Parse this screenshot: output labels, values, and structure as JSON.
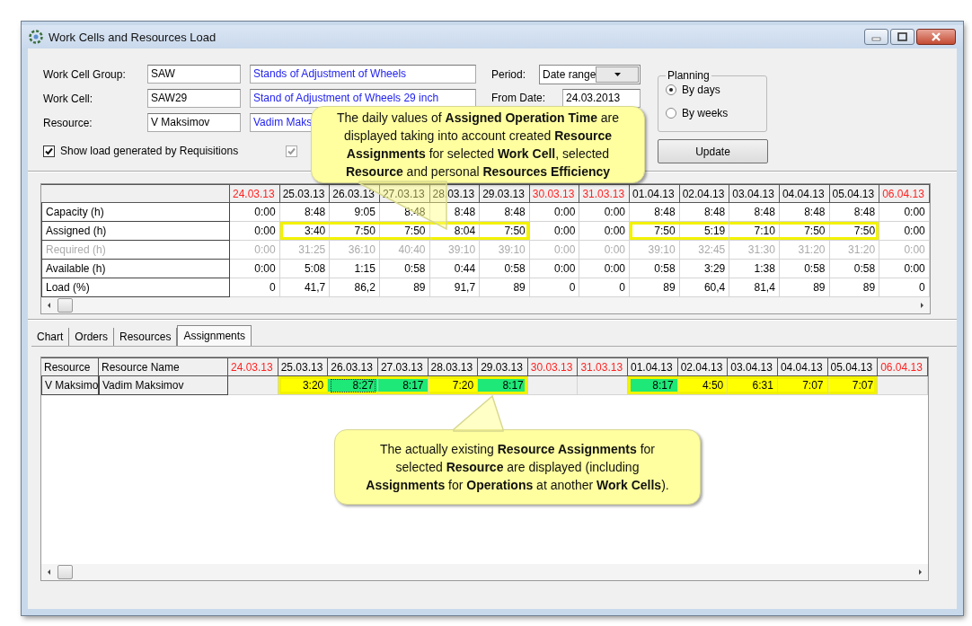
{
  "window": {
    "title": "Work Cells and Resources Load"
  },
  "filters": [
    {
      "label": "Work Cell Group:",
      "code": "SAW",
      "name": "Stands of Adjustment of Wheels"
    },
    {
      "label": "Work Cell:",
      "code": "SAW29",
      "name": "Stand of Adjustment of Wheels 29 inch"
    },
    {
      "label": "Resource:",
      "code": "V Maksimov",
      "name": "Vadim Maks"
    }
  ],
  "checkboxes": [
    {
      "label": "Show load generated by Requisitions",
      "checked": true,
      "disabled": false
    },
    {
      "checked": true,
      "disabled": true
    }
  ],
  "period": {
    "label": "Period:",
    "value": "Date range"
  },
  "from_date": {
    "label": "From Date:",
    "value": "24.03.2013"
  },
  "planning": {
    "title": "Planning",
    "options": [
      {
        "label": "By days",
        "selected": true
      },
      {
        "label": "By weeks",
        "selected": false
      }
    ]
  },
  "update_button": "Update",
  "load_table": {
    "dates": [
      {
        "label": "24.03.13",
        "weekend": true
      },
      {
        "label": "25.03.13",
        "weekend": false
      },
      {
        "label": "26.03.13",
        "weekend": false
      },
      {
        "label": "27.03.13",
        "weekend": false
      },
      {
        "label": "28.03.13",
        "weekend": false
      },
      {
        "label": "29.03.13",
        "weekend": false
      },
      {
        "label": "30.03.13",
        "weekend": true
      },
      {
        "label": "31.03.13",
        "weekend": true
      },
      {
        "label": "01.04.13",
        "weekend": false
      },
      {
        "label": "02.04.13",
        "weekend": false
      },
      {
        "label": "03.04.13",
        "weekend": false
      },
      {
        "label": "04.04.13",
        "weekend": false
      },
      {
        "label": "05.04.13",
        "weekend": false
      },
      {
        "label": "06.04.13",
        "weekend": true
      }
    ],
    "rows": [
      {
        "label": "Capacity (h)",
        "disabled": false,
        "values": [
          {
            "text": "0:00",
            "highlighted": false
          },
          {
            "text": "8:48",
            "highlighted": false
          },
          {
            "text": "9:05",
            "highlighted": false
          },
          {
            "text": "8:48",
            "highlighted": false
          },
          {
            "text": "8:48",
            "highlighted": false
          },
          {
            "text": "8:48",
            "highlighted": false
          },
          {
            "text": "0:00",
            "highlighted": false
          },
          {
            "text": "0:00",
            "highlighted": false
          },
          {
            "text": "8:48",
            "highlighted": false
          },
          {
            "text": "8:48",
            "highlighted": false
          },
          {
            "text": "8:48",
            "highlighted": false
          },
          {
            "text": "8:48",
            "highlighted": false
          },
          {
            "text": "8:48",
            "highlighted": false
          },
          {
            "text": "0:00",
            "highlighted": false
          }
        ]
      },
      {
        "label": "Assigned (h)",
        "disabled": false,
        "values": [
          {
            "text": "0:00",
            "highlighted": false
          },
          {
            "text": "3:40",
            "highlighted": true
          },
          {
            "text": "7:50",
            "highlighted": true
          },
          {
            "text": "7:50",
            "highlighted": true
          },
          {
            "text": "8:04",
            "highlighted": true
          },
          {
            "text": "7:50",
            "highlighted": true
          },
          {
            "text": "0:00",
            "highlighted": false
          },
          {
            "text": "0:00",
            "highlighted": false
          },
          {
            "text": "7:50",
            "highlighted": true
          },
          {
            "text": "5:19",
            "highlighted": true
          },
          {
            "text": "7:10",
            "highlighted": true
          },
          {
            "text": "7:50",
            "highlighted": true
          },
          {
            "text": "7:50",
            "highlighted": true
          },
          {
            "text": "0:00",
            "highlighted": false
          }
        ]
      },
      {
        "label": "Required (h)",
        "disabled": true,
        "values": [
          {
            "text": "0:00",
            "highlighted": false
          },
          {
            "text": "31:25",
            "highlighted": false
          },
          {
            "text": "36:10",
            "highlighted": false
          },
          {
            "text": "40:40",
            "highlighted": false
          },
          {
            "text": "39:10",
            "highlighted": false
          },
          {
            "text": "39:10",
            "highlighted": false
          },
          {
            "text": "0:00",
            "highlighted": false
          },
          {
            "text": "0:00",
            "highlighted": false
          },
          {
            "text": "39:10",
            "highlighted": false
          },
          {
            "text": "32:45",
            "highlighted": false
          },
          {
            "text": "31:30",
            "highlighted": false
          },
          {
            "text": "31:20",
            "highlighted": false
          },
          {
            "text": "31:20",
            "highlighted": false
          },
          {
            "text": "0:00",
            "highlighted": false
          }
        ]
      },
      {
        "label": "Available (h)",
        "disabled": false,
        "values": [
          {
            "text": "0:00",
            "highlighted": false
          },
          {
            "text": "5:08",
            "highlighted": false
          },
          {
            "text": "1:15",
            "highlighted": false
          },
          {
            "text": "0:58",
            "highlighted": false
          },
          {
            "text": "0:44",
            "highlighted": false
          },
          {
            "text": "0:58",
            "highlighted": false
          },
          {
            "text": "0:00",
            "highlighted": false
          },
          {
            "text": "0:00",
            "highlighted": false
          },
          {
            "text": "0:58",
            "highlighted": false
          },
          {
            "text": "3:29",
            "highlighted": false
          },
          {
            "text": "1:38",
            "highlighted": false
          },
          {
            "text": "0:58",
            "highlighted": false
          },
          {
            "text": "0:58",
            "highlighted": false
          },
          {
            "text": "0:00",
            "highlighted": false
          }
        ]
      },
      {
        "label": "Load (%)",
        "disabled": false,
        "values": [
          {
            "text": "0",
            "highlighted": false
          },
          {
            "text": "41,7",
            "highlighted": false
          },
          {
            "text": "86,2",
            "highlighted": false
          },
          {
            "text": "89",
            "highlighted": false
          },
          {
            "text": "91,7",
            "highlighted": false
          },
          {
            "text": "89",
            "highlighted": false
          },
          {
            "text": "0",
            "highlighted": false
          },
          {
            "text": "0",
            "highlighted": false
          },
          {
            "text": "89",
            "highlighted": false
          },
          {
            "text": "60,4",
            "highlighted": false
          },
          {
            "text": "81,4",
            "highlighted": false
          },
          {
            "text": "89",
            "highlighted": false
          },
          {
            "text": "89",
            "highlighted": false
          },
          {
            "text": "0",
            "highlighted": false
          }
        ]
      }
    ]
  },
  "tabs": [
    {
      "label": "Chart",
      "selected": false
    },
    {
      "label": "Orders",
      "selected": false
    },
    {
      "label": "Resources",
      "selected": false
    },
    {
      "label": "Assignments",
      "selected": true
    }
  ],
  "assignments_table": {
    "columns": [
      "Resource",
      "Resource Name"
    ],
    "dates": [
      {
        "label": "24.03.13",
        "weekend": true
      },
      {
        "label": "25.03.13",
        "weekend": false
      },
      {
        "label": "26.03.13",
        "weekend": false
      },
      {
        "label": "27.03.13",
        "weekend": false
      },
      {
        "label": "28.03.13",
        "weekend": false
      },
      {
        "label": "29.03.13",
        "weekend": false
      },
      {
        "label": "30.03.13",
        "weekend": true
      },
      {
        "label": "31.03.13",
        "weekend": true
      },
      {
        "label": "01.04.13",
        "weekend": false
      },
      {
        "label": "02.04.13",
        "weekend": false
      },
      {
        "label": "03.04.13",
        "weekend": false
      },
      {
        "label": "04.04.13",
        "weekend": false
      },
      {
        "label": "05.04.13",
        "weekend": false
      },
      {
        "label": "06.04.13",
        "weekend": true
      }
    ],
    "rows": [
      {
        "resource": "V Maksimo",
        "resource_name": "Vadim Maksimov",
        "values": [
          {
            "highlighted": false
          },
          {
            "text": "3:20",
            "color": "#ffff00",
            "highlighted": true
          },
          {
            "text": "8:27",
            "color": "#1ee878",
            "highlighted": true,
            "selected": true
          },
          {
            "text": "8:17",
            "color": "#1ee878",
            "highlighted": true
          },
          {
            "text": "7:20",
            "color": "#ffff00",
            "highlighted": true
          },
          {
            "text": "8:17",
            "color": "#1ee878",
            "highlighted": true
          },
          {
            "highlighted": false
          },
          {
            "highlighted": false
          },
          {
            "text": "8:17",
            "color": "#1ee878",
            "highlighted": true
          },
          {
            "text": "4:50",
            "color": "#ffff00",
            "highlighted": true
          },
          {
            "text": "6:31",
            "color": "#ffff00",
            "highlighted": true
          },
          {
            "text": "7:07",
            "color": "#ffff00",
            "highlighted": true
          },
          {
            "text": "7:07",
            "color": "#ffff00",
            "highlighted": true
          },
          {
            "highlighted": false
          }
        ]
      }
    ]
  },
  "callouts": [
    {
      "text": "The daily values of **Assigned Operation Time** are displayed taking into account created **Resource Assignments** for selected **Work Cell**, selected **Resource** and personal **Resources Efficiency**"
    },
    {
      "text": "The actually existing **Resource Assignments** for selected **Resource** are displayed (including **Assignments** for **Operations** at another **Work Cells**)."
    }
  ]
}
